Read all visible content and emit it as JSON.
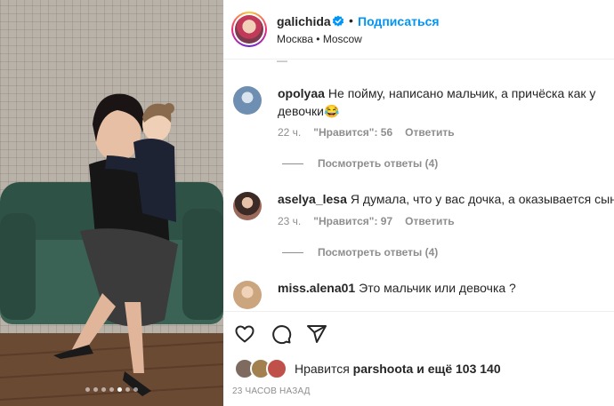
{
  "post": {
    "author": "galichida",
    "follow_label": "Подписаться",
    "separator": "•",
    "location": "Москва • Moscow",
    "carousel": {
      "slides": 7,
      "active_index": 4
    }
  },
  "comments": [
    {
      "username": "opolyaa",
      "text": "Не пойму, написано мальчик, а причёска как у девочки😂",
      "time": "22 ч.",
      "likes": "\"Нравится\": 56",
      "reply_label": "Ответить",
      "view_replies": "Посмотреть ответы (4)",
      "avatar_color": "#6f8fb2"
    },
    {
      "username": "aselya_lesa",
      "text": "Я думала, что у вас дочка, а оказывается сын ...",
      "time": "23 ч.",
      "likes": "\"Нравится\": 97",
      "reply_label": "Ответить",
      "view_replies": "Посмотреть ответы (4)",
      "avatar_color": "#9b6a5a"
    },
    {
      "username": "miss.alena01",
      "text": "Это мальчик или девочка ?",
      "avatar_color": "#caa57e"
    }
  ],
  "footer": {
    "liked_prefix": "Нравится",
    "liked_user": "parshoota",
    "liked_suffix": "и ещё 103 140",
    "timestamp": "23 ЧАСОВ НАЗАД"
  },
  "icons": [
    "verified-badge-icon",
    "heart-icon",
    "comment-icon",
    "share-icon"
  ],
  "colors": {
    "accent": "#0095f6",
    "text": "#262626",
    "muted": "#8e8e8e"
  }
}
